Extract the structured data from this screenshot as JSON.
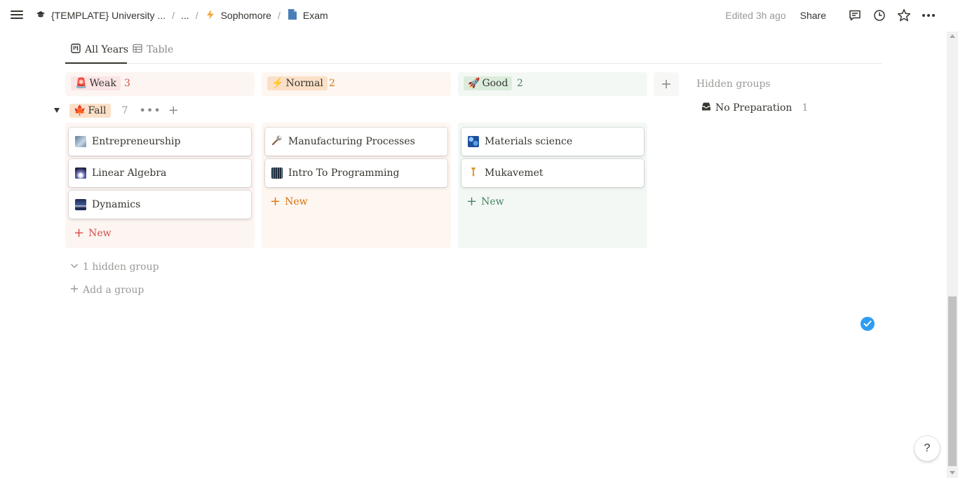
{
  "breadcrumb": {
    "items": [
      {
        "icon": "graduation-cap-icon",
        "label": "{TEMPLATE} University ..."
      },
      {
        "icon": "",
        "label": "..."
      },
      {
        "icon": "lightning-icon",
        "label": "Sophomore"
      },
      {
        "icon": "page-icon",
        "label": "Exam"
      }
    ],
    "separator": "/"
  },
  "topbar": {
    "edited": "Edited 3h ago",
    "share_label": "Share",
    "icons": [
      "comment-icon",
      "clock-icon",
      "star-icon",
      "more-icon"
    ]
  },
  "views": {
    "active": {
      "icon": "board-icon",
      "label": "All Years"
    },
    "other": {
      "icon": "table-icon",
      "label": "Table"
    }
  },
  "columns": [
    {
      "emoji": "🚨",
      "label": "Weak",
      "count": "3",
      "color": "#d44c47"
    },
    {
      "emoji": "⚡",
      "label": "Normal",
      "count": "2",
      "color": "#d9730d"
    },
    {
      "emoji": "🚀",
      "label": "Good",
      "count": "2",
      "color": "#448361"
    }
  ],
  "hidden_groups": {
    "title": "Hidden groups",
    "items": [
      {
        "icon": "inbox-icon",
        "label": "No Preparation",
        "count": "1"
      }
    ]
  },
  "group": {
    "emoji": "🍁",
    "label": "Fall",
    "count": "7",
    "more": "•••",
    "add": "+"
  },
  "cards": {
    "weak": [
      "Entrepreneurship",
      "Linear Algebra",
      "Dynamics"
    ],
    "normal": [
      "Manufacturing Processes",
      "Intro To Programming"
    ],
    "good": [
      "Materials science",
      "Mukavemet"
    ]
  },
  "new_label": "New",
  "footer": {
    "hidden_group_label": "1 hidden group",
    "add_group_label": "Add a group"
  },
  "help_label": "?"
}
